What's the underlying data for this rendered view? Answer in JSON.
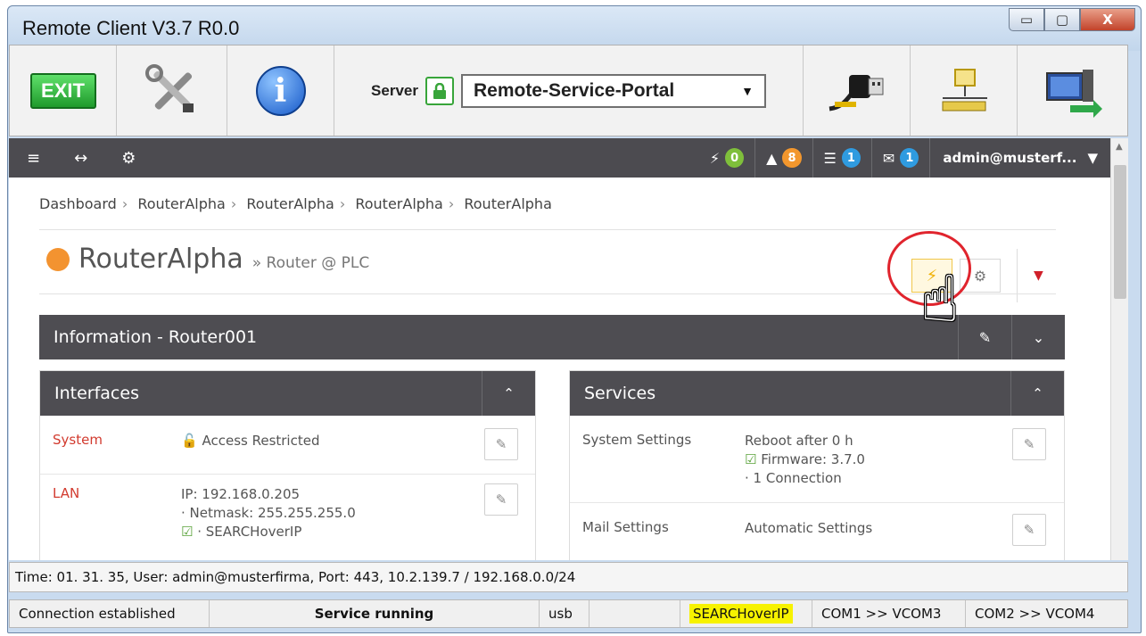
{
  "window": {
    "title": "Remote Client V3.7 R0.0",
    "controls": {
      "minimize": "▭",
      "maximize": "▢",
      "close": "X"
    }
  },
  "toolbar": {
    "exit_label": "EXIT",
    "tools_icon": "tools-icon",
    "info_label": "i",
    "server_label": "Server",
    "server_value": "Remote-Service-Portal",
    "connect_icon": "usb-plug-icon",
    "network_icon": "network-device-icon",
    "remote_desktop_icon": "remote-desktop-icon"
  },
  "navbar": {
    "menu_icon": "≡",
    "arrows_icon": "↔",
    "settings_icon": "⚙",
    "bolt_icon": "⚡",
    "bolt_count": "0",
    "warning_icon": "▲",
    "warning_count": "8",
    "server_icon": "☰",
    "server_count": "1",
    "mail_icon": "✉",
    "mail_count": "1",
    "user": "admin@musterf...",
    "user_caret": "▼"
  },
  "breadcrumb": [
    "Dashboard",
    "RouterAlpha",
    "RouterAlpha",
    "RouterAlpha",
    "RouterAlpha"
  ],
  "page": {
    "title": "RouterAlpha",
    "subtitle": "» Router @ PLC",
    "status_color": "#f39330"
  },
  "info_section": {
    "title": "Information - Router001",
    "collapse": "⌄"
  },
  "interfaces": {
    "title": "Interfaces",
    "collapse": "⌃",
    "rows": [
      {
        "key": "System",
        "lines": [
          "Access Restricted"
        ]
      },
      {
        "key": "LAN",
        "lines": [
          "IP: 192.168.0.205",
          "· Netmask: 255.255.255.0",
          "· SEARCHoverIP"
        ]
      }
    ]
  },
  "services": {
    "title": "Services",
    "collapse": "⌃",
    "rows": [
      {
        "key": "System Settings",
        "lines": [
          "Reboot after 0 h",
          "Firmware: 3.7.0",
          "· 1 Connection"
        ]
      },
      {
        "key": "Mail Settings",
        "lines": [
          "Automatic Settings"
        ]
      }
    ]
  },
  "footer": {
    "info_line": "Time: 01. 31. 35, User: admin@musterfirma, Port: 443, 10.2.139.7 / 192.168.0.0/24",
    "status": {
      "connection": "Connection established",
      "service": "Service running",
      "usb": "usb",
      "search": "SEARCHoverIP",
      "com1": "COM1 >> VCOM3",
      "com2": "COM2 >> VCOM4"
    }
  },
  "colors": {
    "accent_orange": "#f39330",
    "dark_bar": "#4e4d52",
    "highlight_yellow": "#f7f200",
    "ring_red": "#e0242d"
  }
}
